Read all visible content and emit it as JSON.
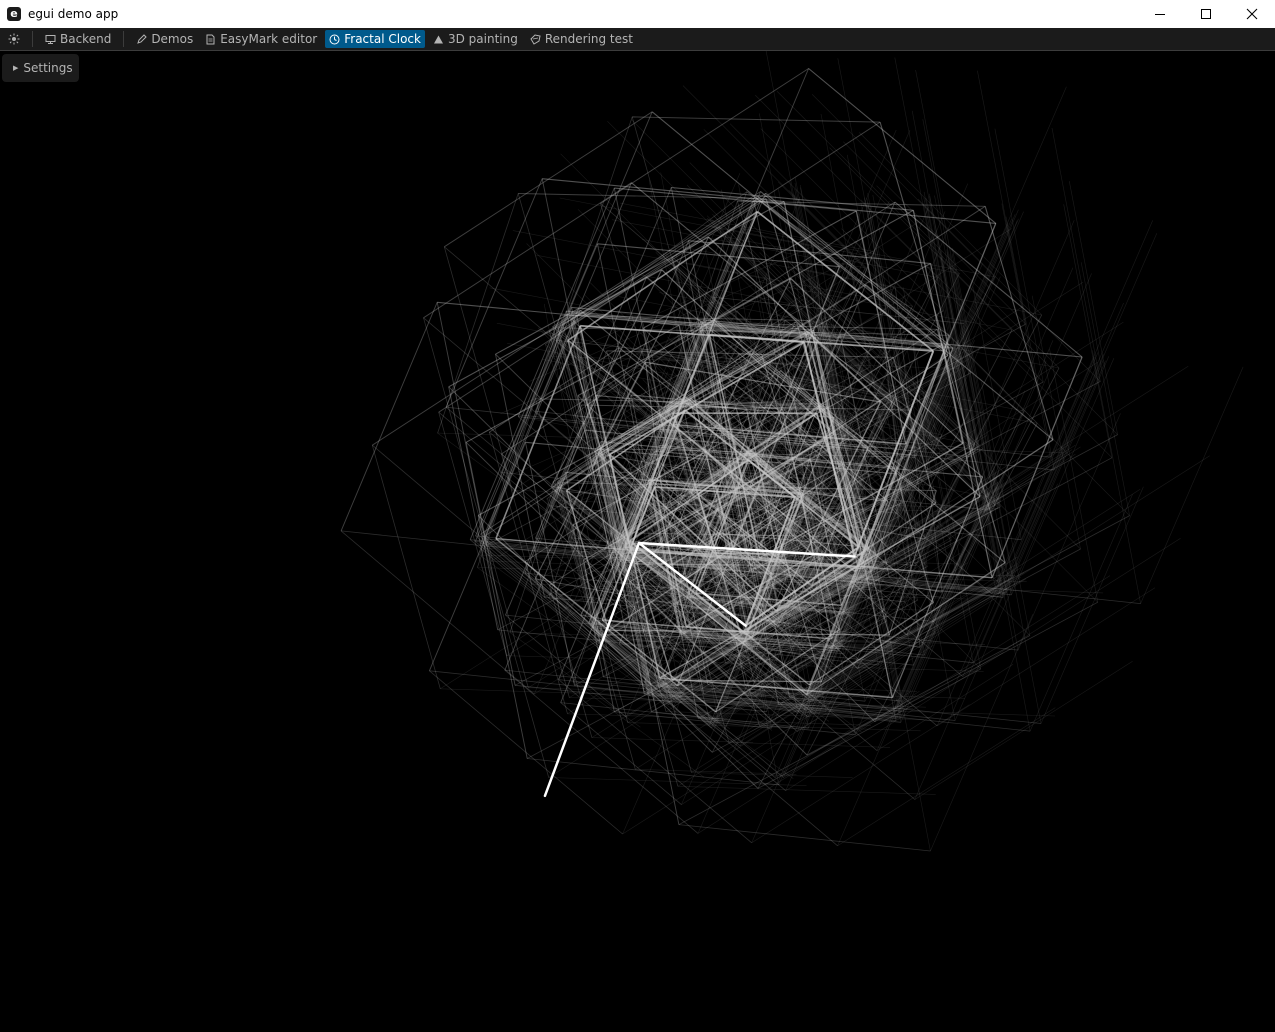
{
  "window": {
    "title": "egui demo app",
    "app_icon_letter": "e"
  },
  "menubar": {
    "items": [
      {
        "label": "Backend",
        "icon": "computer-icon"
      },
      {
        "label": "Demos",
        "icon": "pencil-icon"
      },
      {
        "label": "EasyMark editor",
        "icon": "document-icon"
      },
      {
        "label": "Fractal Clock",
        "icon": "clock-icon",
        "active": true
      },
      {
        "label": "3D painting",
        "icon": "triangle-icon"
      },
      {
        "label": "Rendering test",
        "icon": "rendering-icon"
      }
    ]
  },
  "settings": {
    "label": "Settings",
    "collapsed": true
  },
  "colors": {
    "accent": "#005a8c",
    "panel": "#1b1b1b",
    "text": "#b4b4b4",
    "background": "#000000"
  },
  "clock": {
    "hours": 4.26,
    "minutes": 15.6,
    "seconds": 33.4
  }
}
